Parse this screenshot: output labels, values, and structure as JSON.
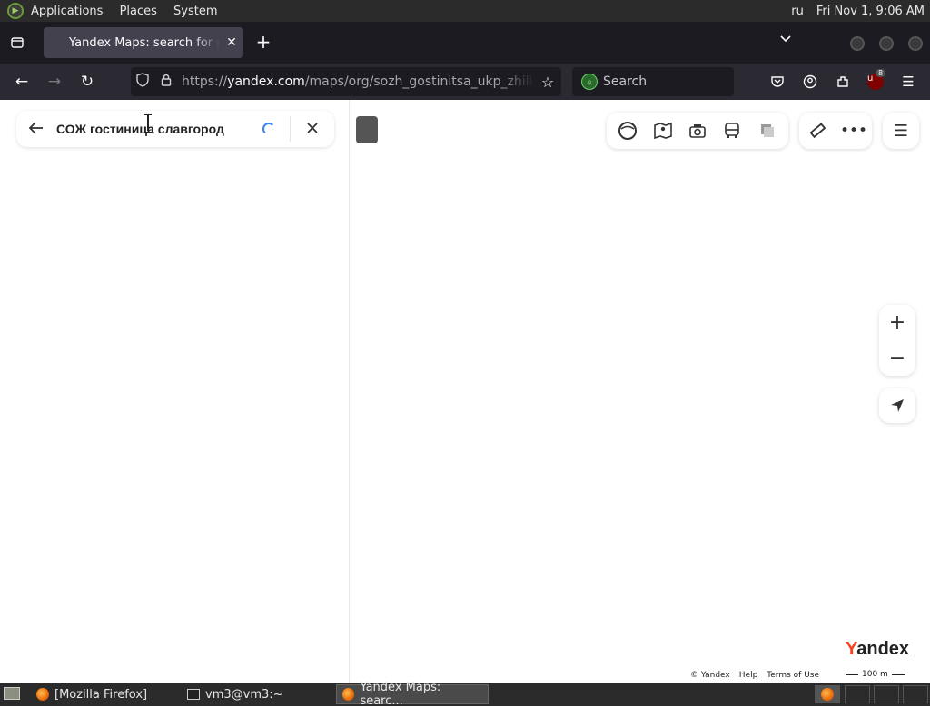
{
  "system_panel": {
    "menus": [
      "Applications",
      "Places",
      "System"
    ],
    "language": "ru",
    "clock": "Fri Nov 1,  9:06 AM"
  },
  "browser": {
    "tab_title": "Yandex Maps: search for places, transport and routes",
    "url_prefix": "https://",
    "url_host": "yandex.com",
    "url_path": "/maps/org/sozh_gostinitsa_ukp_zhilkombinat/",
    "search_placeholder": "Search",
    "extension_badge": "8",
    "icons": {
      "back": "←",
      "forward": "→",
      "reload": "↻",
      "star": "☆",
      "new_tab": "+",
      "close_tab": "✕",
      "overflow": "⌄"
    }
  },
  "maps": {
    "search_query": "СОЖ гостиница славгород",
    "logo_first": "Y",
    "logo_rest": "andex",
    "footer": {
      "copyright": "© Yandex",
      "help": "Help",
      "terms": "Terms of Use"
    },
    "scale_label": "100 m",
    "zoom_in": "+",
    "zoom_out": "−"
  },
  "taskbar": {
    "items": [
      "[Mozilla Firefox]",
      "vm3@vm3:~",
      "Yandex Maps: searc..."
    ]
  }
}
